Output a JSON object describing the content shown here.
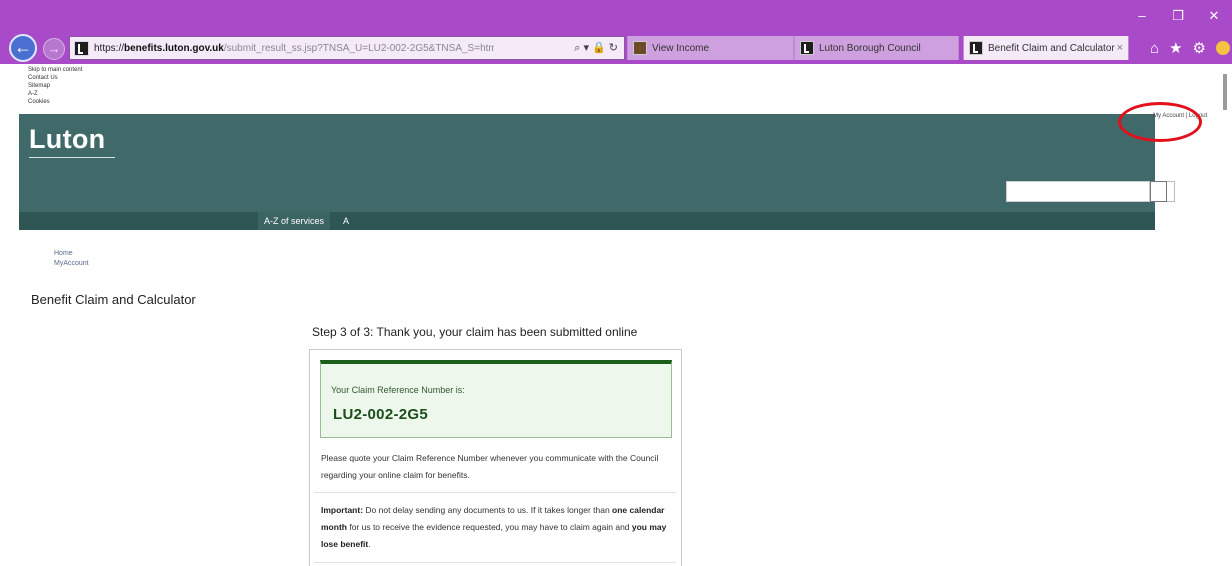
{
  "browser": {
    "url_proto": "https://",
    "url_host": "benefits.luton.gov.uk",
    "url_rest": "/submit_result_ss.jsp?TNSA_U=LU2-002-2G5&TNSA_S=html",
    "addr_icons": "⌕ ▾ 🔒 ↻",
    "tabs": [
      {
        "label": "View Income",
        "active": false
      },
      {
        "label": "Luton Borough Council",
        "active": false
      },
      {
        "label": "Benefit Claim and Calculator",
        "active": true
      }
    ],
    "tab_close": "×",
    "window_controls": {
      "minimize": "–",
      "restore": "❐",
      "close": "✕"
    },
    "toolbar_icons": {
      "home": "⌂",
      "favorites": "★",
      "settings": "⚙"
    }
  },
  "skip_links": [
    "Skip to main content",
    "Contact Us",
    "Sitemap",
    "A-Z",
    "Cookies"
  ],
  "account_links": "My Account | Logout",
  "header": {
    "logo": "Luton",
    "nav": {
      "az_label": "A-Z of services",
      "a_label": "A"
    }
  },
  "breadcrumb": [
    "Home",
    "MyAccount"
  ],
  "page": {
    "title": "Benefit Claim and Calculator",
    "step_title": "Step 3 of 3: Thank you, your claim has been submitted online",
    "ref_label": "Your Claim Reference Number is:",
    "ref_number": "LU2-002-2G5",
    "quote_text": "Please quote your Claim Reference Number whenever you communicate with the Council regarding your online claim for benefits.",
    "important": {
      "label": "Important:",
      "text1": " Do not delay sending any documents to us. If it takes longer than ",
      "bold1": "one calendar month",
      "text2": " for us to receive the evidence requested, you may have to claim again and ",
      "bold2": "you may lose benefit",
      "text3": "."
    }
  },
  "colors": {
    "browser_frame": "#a94bc8",
    "banner": "#3f6a69",
    "nav": "#2f5655",
    "ref_border": "#1c5e1c",
    "annotation_circle": "#e3101b"
  }
}
